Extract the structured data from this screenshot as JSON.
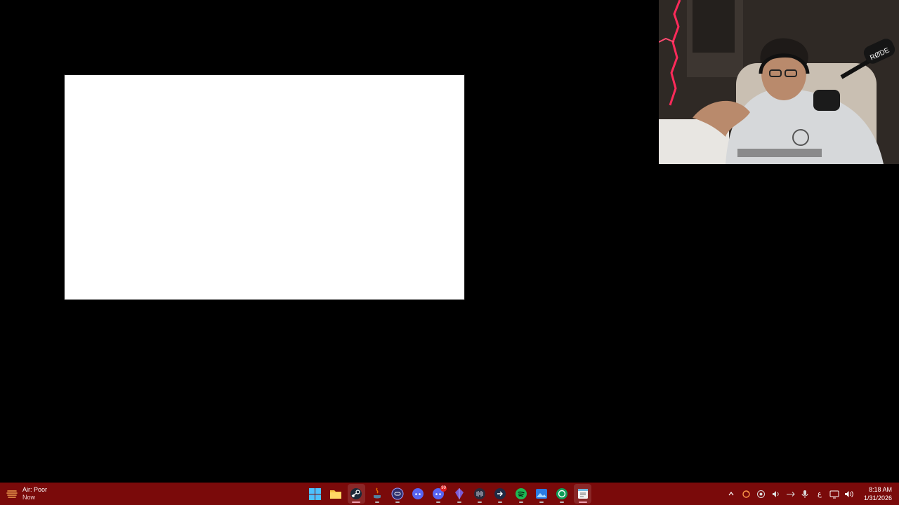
{
  "taskbar": {
    "weather": {
      "icon": "haze-icon",
      "title": "Air: Poor",
      "subtitle": "Now"
    },
    "apps": [
      {
        "name": "start-button",
        "icon": "windows-logo-icon",
        "active": false
      },
      {
        "name": "taskbar-app-file-explorer",
        "icon": "folder-icon",
        "active": false
      },
      {
        "name": "taskbar-app-steam",
        "icon": "steam-icon",
        "active": true
      },
      {
        "name": "taskbar-app-java",
        "icon": "java-icon",
        "active": false
      },
      {
        "name": "taskbar-app-controller",
        "icon": "gamepad-icon",
        "active": false
      },
      {
        "name": "taskbar-app-discord",
        "icon": "discord-icon",
        "active": false
      },
      {
        "name": "taskbar-app-discord-2",
        "icon": "discord-icon",
        "active": false,
        "badge": "99"
      },
      {
        "name": "taskbar-app-obsidian",
        "icon": "crystal-icon",
        "active": false
      },
      {
        "name": "taskbar-app-audio",
        "icon": "waveform-icon",
        "active": false
      },
      {
        "name": "taskbar-app-arrow",
        "icon": "arrow-circle-icon",
        "active": false
      },
      {
        "name": "taskbar-app-spotify",
        "icon": "spotify-icon",
        "active": false
      },
      {
        "name": "taskbar-app-photos",
        "icon": "photos-icon",
        "active": false
      },
      {
        "name": "taskbar-app-green",
        "icon": "green-circle-icon",
        "active": false
      },
      {
        "name": "taskbar-app-notepad",
        "icon": "notepad-icon",
        "active": true
      }
    ],
    "tray": [
      "chevron-up-icon",
      "sync-icon",
      "settings-circle-icon",
      "speaker-icon",
      "network-icon",
      "microphone-icon",
      "ime-icon",
      "display-icon",
      "volume-icon"
    ],
    "ime_label": "ع",
    "clock": {
      "time": "8:18 AM",
      "date": "1/31/2026"
    }
  },
  "colors": {
    "taskbar_bg": "#7a0a0a",
    "desktop_bg": "#000000"
  }
}
